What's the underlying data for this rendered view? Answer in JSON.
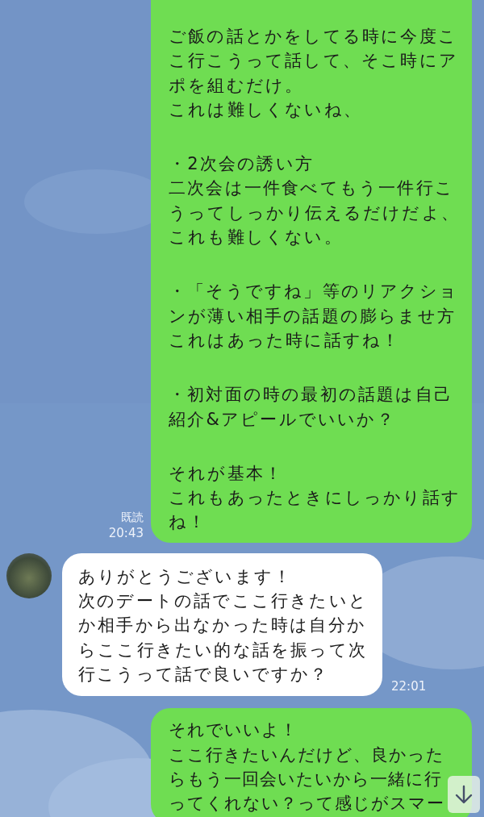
{
  "messages": [
    {
      "kind": "outgoing",
      "blocks": [
        [
          "ご飯の話とかをしてる時に今度ここ行こうって話して、そこ時にアポを組むだけ。",
          "これは難しくないね、"
        ],
        [
          "・2次会の誘い方",
          "二次会は一件食べてもう一件行こうってしっかり伝えるだけだよ、",
          "これも難しくない。"
        ],
        [
          "・「そうですね」等のリアクションが薄い相手の話題の膨らませ方",
          "これはあった時に話すね！"
        ],
        [
          "・初対面の時の最初の話題は自己紹介&アピールでいいか？"
        ],
        [
          "それが基本！",
          "これもあったときにしっかり話すね！"
        ]
      ],
      "read_label": "既読",
      "time": "20:43"
    },
    {
      "kind": "incoming",
      "blocks": [
        [
          "ありがとうございます！",
          "次のデートの話でここ行きたいとか相手から出なかった時は自分からここ行きたい的な話を振って次行こうって話で良いですか？"
        ]
      ],
      "time": "22:01"
    },
    {
      "kind": "outgoing",
      "blocks": [
        [
          "それでいいよ！",
          "ここ行きたいんだけど、良かったらもう一回会いたいから一緒に行ってくれない？って感じがスマー"
        ]
      ]
    }
  ]
}
